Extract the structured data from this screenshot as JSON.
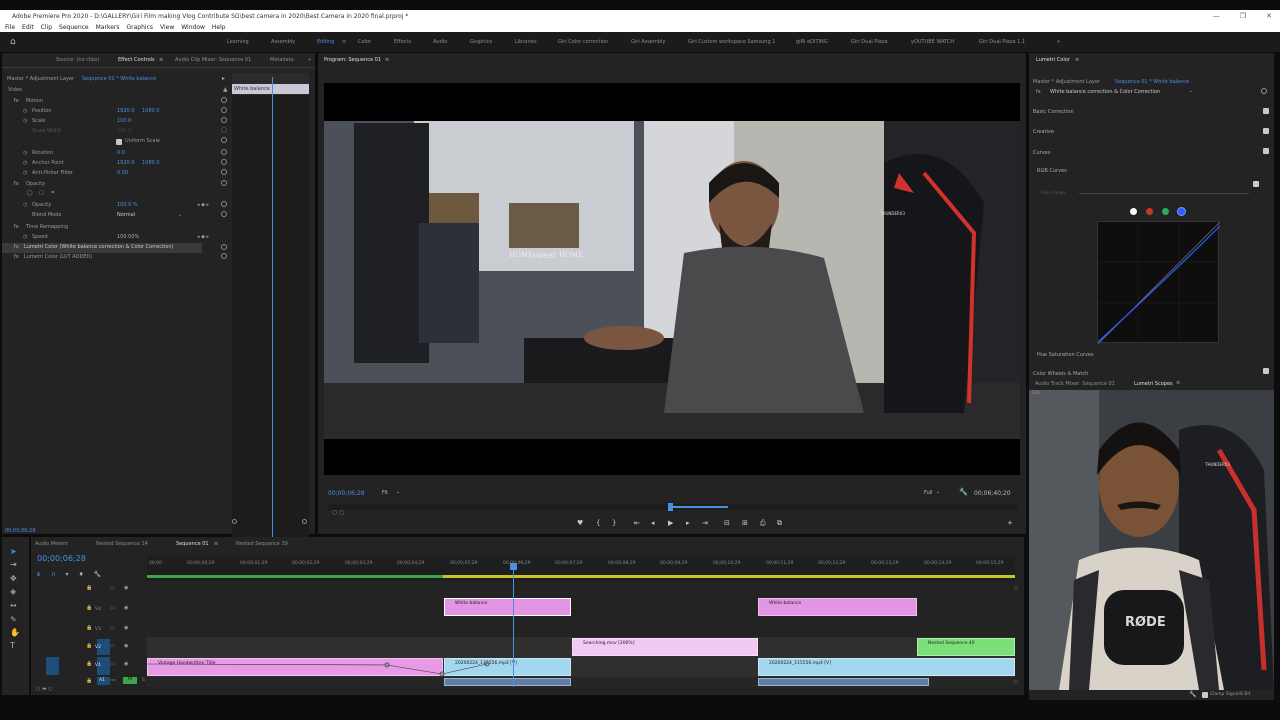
{
  "window": {
    "title": "Adobe Premiere Pro 2020 - D:\\GALLERY\\Giri Film making Vlog Contribute SG\\best camera in 2020\\Best Camera in 2020 final.prproj *",
    "controls": [
      "—",
      "❐",
      "✕"
    ]
  },
  "menu": [
    "File",
    "Edit",
    "Clip",
    "Sequence",
    "Markers",
    "Graphics",
    "View",
    "Window",
    "Help"
  ],
  "workspaces": {
    "items": [
      "Learning",
      "Assembly",
      "Editing",
      "Color",
      "Effects",
      "Audio",
      "Graphics",
      "Libraries",
      "Giri Color correction",
      "Giri Assembly",
      "Giri Custom workspace Samsung 1",
      "giRI eDITING",
      "Giri Dual Plaza",
      "yOUTUBE WATCH",
      "Giri Dual Plaza 1.1"
    ],
    "active": "Editing",
    "more": "»"
  },
  "source_panel": {
    "tabs": [
      "Source: (no clips)",
      "Effect Controls",
      "Audio Clip Mixer: Sequence 01",
      "Metadata"
    ],
    "active_tab": "Effect Controls",
    "master": "Master * Adjustment Layer",
    "sequence": "Sequence 01 * White balance",
    "mini_clip": "White balance",
    "section": "Video",
    "rows": [
      {
        "label": "Motion",
        "value": "",
        "value2": ""
      },
      {
        "label": "Position",
        "value": "1920.0",
        "value2": "1080.0"
      },
      {
        "label": "Scale",
        "value": "100.0",
        "value2": ""
      },
      {
        "label": "Scale Width",
        "value": "100.0",
        "value2": ""
      },
      {
        "label": "Uniform Scale",
        "value": "",
        "value2": ""
      },
      {
        "label": "Rotation",
        "value": "0.0",
        "value2": ""
      },
      {
        "label": "Anchor Point",
        "value": "1920.0",
        "value2": "1080.0"
      },
      {
        "label": "Anti-flicker Filter",
        "value": "0.00",
        "value2": ""
      },
      {
        "label": "Opacity",
        "value": "",
        "value2": ""
      },
      {
        "label": "Opacity",
        "value": "100.0 %",
        "value2": ""
      },
      {
        "label": "Blend Mode",
        "value": "Normal",
        "value2": ""
      },
      {
        "label": "Time Remapping",
        "value": "",
        "value2": ""
      },
      {
        "label": "Speed",
        "value": "100.00%",
        "value2": ""
      },
      {
        "label": "Lumetri Color (White balance correction & Color Correction)",
        "value": "",
        "value2": ""
      },
      {
        "label": "Lumetri Color (LUT ADDED)",
        "value": "",
        "value2": ""
      }
    ],
    "timecode": "00;00;06;28"
  },
  "program_monitor": {
    "title": "Program: Sequence 01",
    "timecode": "00;00;06;28",
    "fit": "Fit",
    "quality": "Full",
    "duration": "00;06;40;20",
    "video_texts": [
      "HOME",
      "sweet",
      "HOME",
      "THUNDERX3"
    ]
  },
  "lumetri": {
    "title": "Lumetri Color",
    "master": "Master * Adjustment Layer",
    "sequence": "Sequence 01 * White balance",
    "effect": "White balance correction & Color Correction",
    "sections": [
      "Basic Correction",
      "Creative",
      "Curves",
      "RGB Curves",
      "HSL Range",
      "Hue Saturation Curves",
      "Color Wheels & Match"
    ],
    "channel_colors": [
      "#ffffff",
      "#c0392b",
      "#27ae60",
      "#2f5bff"
    ]
  },
  "scopes_panel": {
    "tabs": [
      "Audio Track Mixer: Sequence 01",
      "Lumetri Scopes"
    ],
    "active_tab": "Lumetri Scopes",
    "scale_label": "120",
    "clamp_signal": "Clamp Signal",
    "bit_depth": "8 Bit"
  },
  "webcam": {
    "shirt_text": "RØDE",
    "chair_text": "THUNDERX3"
  },
  "timeline": {
    "tabs": [
      "Audio Meters",
      "Nested Sequence 14",
      "Sequence 01",
      "Nested Sequence 39"
    ],
    "active_tab": "Sequence 01",
    "timecode": "00;00;06;28",
    "ruler": [
      "00;00",
      "00;00;00;29",
      "00;00;01;29",
      "00;00;02;29",
      "00;00;03;29",
      "00;00;04;29",
      "00;00;05;29",
      "00;00;06;29",
      "00;00;07;29",
      "00;00;08;29",
      "00;00;09;29",
      "00;00;10;29",
      "00;00;11;29",
      "00;00;12;29",
      "00;00;13;29",
      "00;00;14;29",
      "00;00;15;29"
    ],
    "tracks": [
      "V5",
      "V4",
      "V3",
      "V2",
      "V1",
      "A1"
    ],
    "clips": {
      "wb1": "White balance",
      "wb2": "White balance",
      "searching": "Searching.mov [200%]",
      "nested": "Nested Sequence 40",
      "vintage": "Vintage Handwritten Title",
      "v1a": "20200224_115556.mp4 [V]",
      "v1b": "20200224_115556.mp4 [V]"
    },
    "a1_label": "M",
    "a1_vol": "0.0"
  }
}
